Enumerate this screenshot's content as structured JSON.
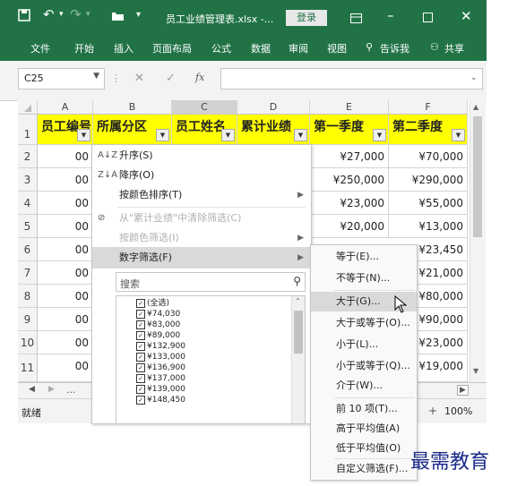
{
  "titlebar": {
    "title": "员工业绩管理表.xlsx  -...",
    "login_label": "登录"
  },
  "ribbon": {
    "tabs": [
      "文件",
      "开始",
      "插入",
      "页面布局",
      "公式",
      "数据",
      "审阅",
      "视图"
    ],
    "tellme": "告诉我",
    "share": "共享"
  },
  "formula_bar": {
    "name_box": "C25",
    "fx": "fx",
    "formula": ""
  },
  "columns": [
    "A",
    "B",
    "C",
    "D",
    "E",
    "F"
  ],
  "rows": [
    "1",
    "2",
    "3",
    "4",
    "5",
    "6",
    "7",
    "8",
    "9",
    "10",
    "11"
  ],
  "header_row": [
    "员工编号",
    "所属分区",
    "员工姓名",
    "累计业绩",
    "第一季度",
    "第二季度"
  ],
  "col_a_partial": [
    "00",
    "00",
    "00",
    "00",
    "00",
    "00",
    "00",
    "00",
    "00",
    "00"
  ],
  "col_e_values": [
    "¥27,000",
    "¥250,000",
    "¥23,000",
    "¥20,000"
  ],
  "col_f_values": [
    "¥70,000",
    "¥290,000",
    "¥55,000",
    "¥13,000",
    "¥23,450",
    "¥21,000",
    "¥80,000",
    "¥90,000",
    "¥23,000",
    "¥19,000"
  ],
  "status": {
    "ready": "就绪",
    "zoom": "100%",
    "sheet_nav": "..."
  },
  "filter_menu": {
    "sort_asc": "升序(S)",
    "sort_desc": "降序(O)",
    "sort_color": "按颜色排序(T)",
    "clear_filter": "从\"累计业绩\"中清除筛选(C)",
    "filter_color": "按颜色筛选(I)",
    "number_filter": "数字筛选(F)",
    "search_placeholder": "搜索",
    "list_items": [
      "(全选)",
      "¥74,030",
      "¥83,000",
      "¥89,000",
      "¥132,900",
      "¥133,000",
      "¥136,900",
      "¥137,000",
      "¥139,000",
      "¥148,450"
    ]
  },
  "number_submenu": {
    "items": [
      "等于(E)...",
      "不等于(N)...",
      "大于(G)...",
      "大于或等于(O)...",
      "小于(L)...",
      "小于或等于(Q)...",
      "介于(W)...",
      "前 10 项(T)...",
      "高于平均值(A)",
      "低于平均值(O)",
      "自定义筛选(F)..."
    ]
  },
  "watermark": "最需教育",
  "colors": {
    "excel_green": "#217346",
    "header_fill": "#ffff00",
    "hover": "#d9d9d9"
  }
}
